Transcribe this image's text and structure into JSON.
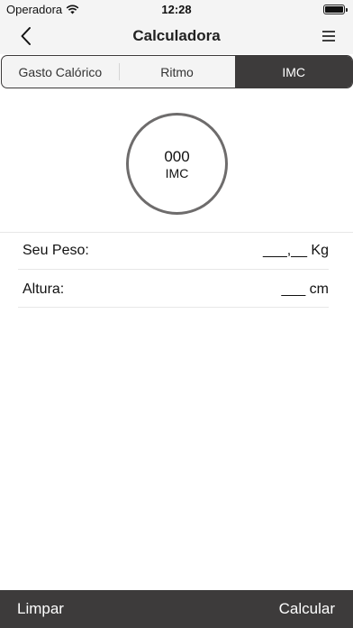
{
  "status_bar": {
    "carrier": "Operadora",
    "time": "12:28",
    "icons": [
      "wifi-icon",
      "battery-icon"
    ]
  },
  "nav": {
    "title": "Calculadora",
    "back_icon": "chevron-left-icon",
    "menu_icon": "hamburger-menu-icon"
  },
  "tabs": [
    {
      "label": "Gasto Calórico",
      "active": false
    },
    {
      "label": "Ritmo",
      "active": false
    },
    {
      "label": "IMC",
      "active": true
    }
  ],
  "result": {
    "value": "000",
    "label": "IMC"
  },
  "fields": {
    "weight": {
      "label": "Seu Peso:",
      "value": "___,__  Kg"
    },
    "height": {
      "label": "Altura:",
      "value": "___  cm"
    }
  },
  "bottom_bar": {
    "clear_label": "Limpar",
    "calculate_label": "Calcular"
  },
  "colors": {
    "accent_dark": "#3d3b3b",
    "bar_background": "#f4f4f4",
    "circle_border": "#6e6c6c"
  }
}
